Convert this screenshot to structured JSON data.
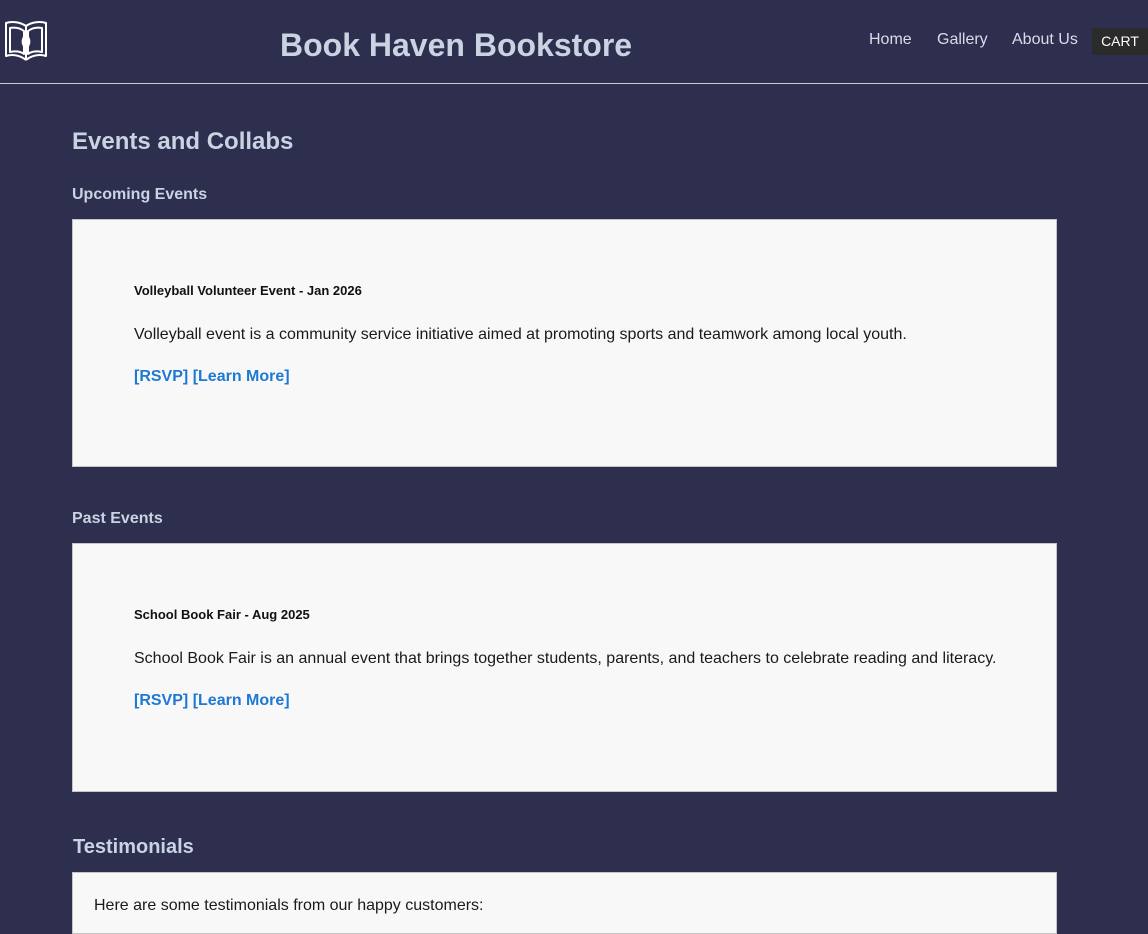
{
  "header": {
    "logo_icon": "open-book-logo-icon",
    "site_title": "Book Haven Bookstore",
    "nav": [
      {
        "label": "Home"
      },
      {
        "label": "Gallery"
      },
      {
        "label": "About Us"
      }
    ],
    "cart_label": "CART"
  },
  "main": {
    "page_heading": "Events and Collabs",
    "upcoming": {
      "heading": "Upcoming Events",
      "event": {
        "title": "Volleyball Volunteer Event - Jan 2026",
        "description": "Volleyball event is a community service initiative aimed at promoting sports and teamwork among local youth.",
        "rsvp_label": "[RSVP]",
        "learn_more_label": "[Learn More]"
      }
    },
    "past": {
      "heading": "Past Events",
      "event": {
        "title": "School Book Fair - Aug 2025",
        "description": "School Book Fair is an annual event that brings together students, parents, and teachers to celebrate reading and literacy.",
        "rsvp_label": "[RSVP]",
        "learn_more_label": "[Learn More]"
      }
    },
    "testimonials": {
      "heading": "Testimonials",
      "intro": "Here are some testimonials from our happy customers:"
    }
  },
  "colors": {
    "background": "#2e2e4f",
    "heading_text": "#c9d3e2",
    "card_background": "#f8f8f8",
    "link": "#1f78d1",
    "cart_background": "#2b2b2b"
  }
}
